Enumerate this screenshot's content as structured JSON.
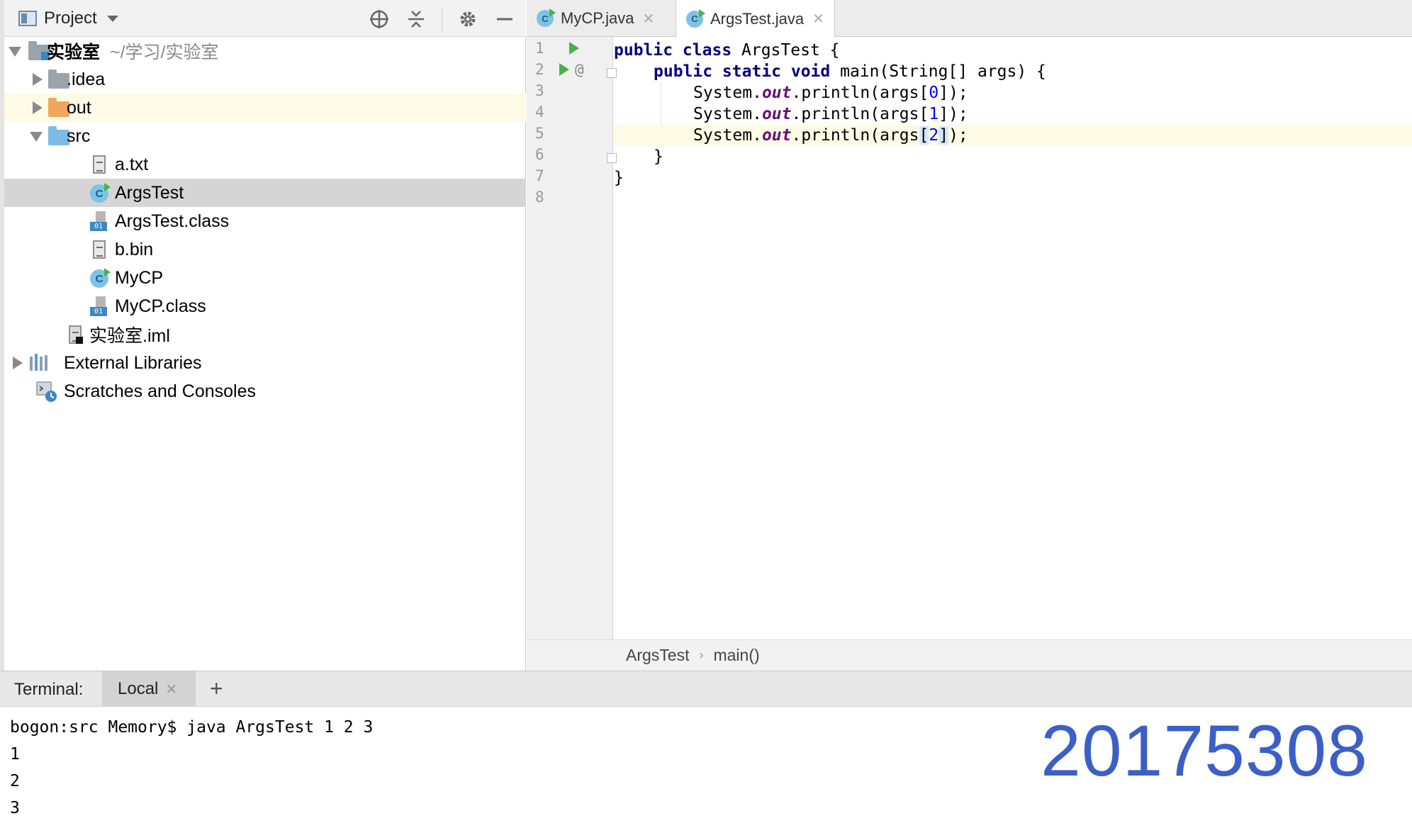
{
  "project_panel": {
    "title": "Project",
    "tree": {
      "root_name": "实验室",
      "root_path": "~/学习/实验室",
      "idea": ".idea",
      "out": "out",
      "src": "src",
      "a_txt": "a.txt",
      "argstest": "ArgsTest",
      "argstest_class": "ArgsTest.class",
      "b_bin": "b.bin",
      "mycp": "MyCP",
      "mycp_class": "MyCP.class",
      "iml": "实验室.iml",
      "external_libraries": "External Libraries",
      "scratches": "Scratches and Consoles"
    },
    "bin_badge": "01"
  },
  "editor": {
    "tabs": [
      {
        "label": "MyCP.java"
      },
      {
        "label": "ArgsTest.java"
      }
    ],
    "class_icon_letter": "C",
    "line_numbers": [
      "1",
      "2",
      "3",
      "4",
      "5",
      "6",
      "7",
      "8"
    ],
    "at_marker": "@",
    "code": {
      "l1_kw": "public class",
      "l1_rest": " ArgsTest {",
      "l2_kw": "public static void",
      "l2_rest": " main(String[] args) {",
      "sys": "System.",
      "out": "out",
      "println": ".println(args",
      "idx0": "0",
      "idx1": "1",
      "idx2": "2",
      "close_stmt": ");",
      "brace": "}"
    },
    "breadcrumb": {
      "class": "ArgsTest",
      "method": "main()"
    }
  },
  "terminal": {
    "title": "Terminal:",
    "tab": "Local",
    "add": "+",
    "lines": [
      "bogon:src Memory$ java ArgsTest 1 2 3",
      "1",
      "2",
      "3"
    ],
    "watermark": "20175308"
  },
  "colors": {
    "keyword": "#000080",
    "static_field": "#660e7a",
    "number": "#0000ff",
    "watermark": "#3c5fc6",
    "run_icon": "#4caf50"
  }
}
